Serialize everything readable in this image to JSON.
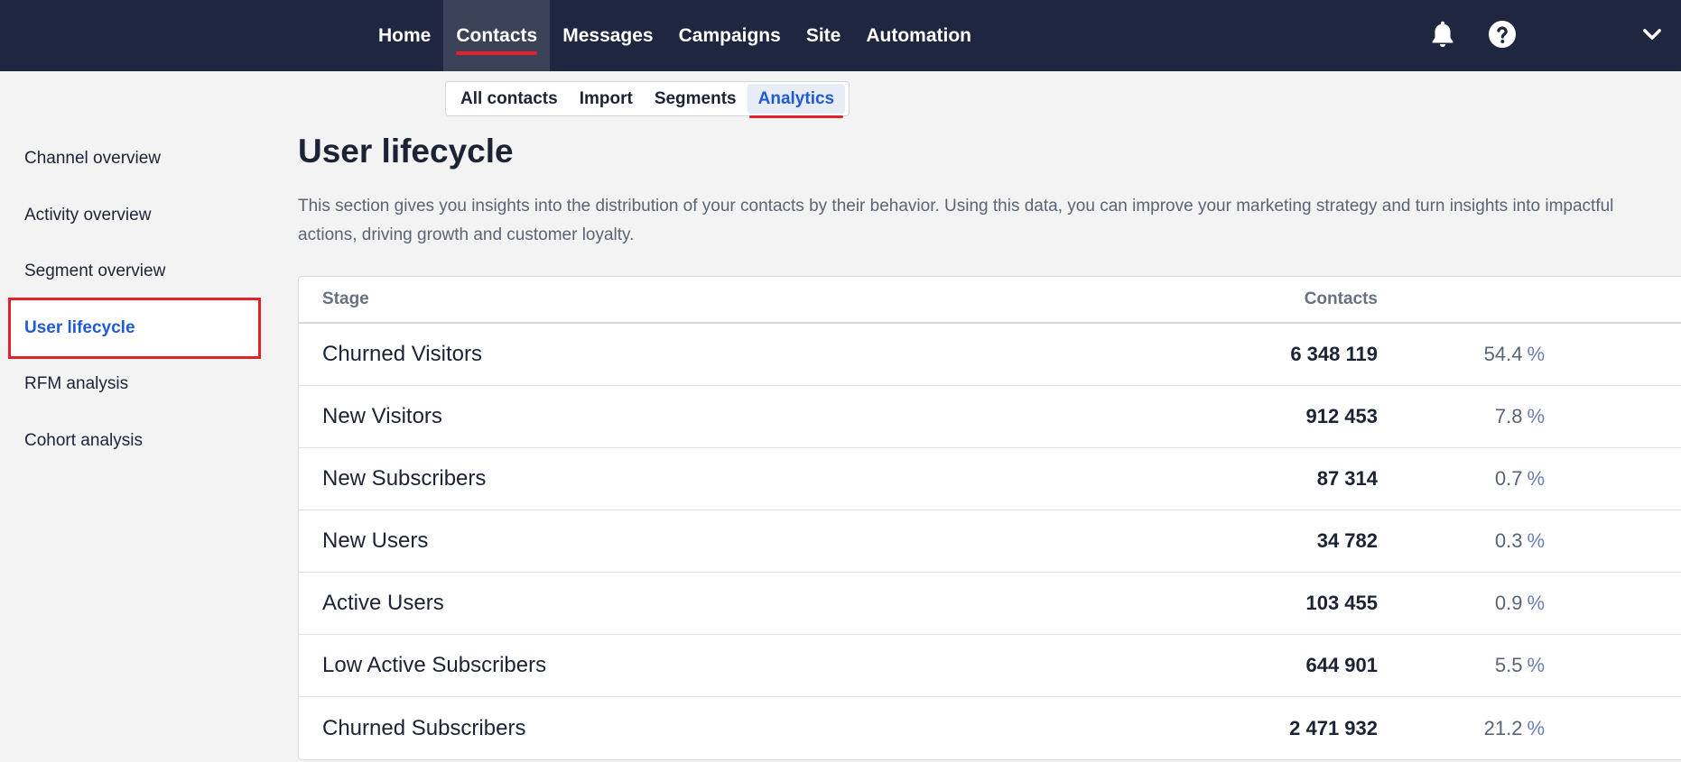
{
  "topnav": {
    "items": [
      {
        "label": "Home"
      },
      {
        "label": "Contacts",
        "active": true
      },
      {
        "label": "Messages"
      },
      {
        "label": "Campaigns"
      },
      {
        "label": "Site"
      },
      {
        "label": "Automation"
      }
    ],
    "icons": [
      "bell-icon",
      "help-icon",
      "chevron-down-icon"
    ]
  },
  "subtabs": {
    "items": [
      {
        "label": "All contacts"
      },
      {
        "label": "Import"
      },
      {
        "label": "Segments"
      },
      {
        "label": "Analytics",
        "active": true
      }
    ]
  },
  "sidebar": {
    "items": [
      {
        "label": "Channel overview"
      },
      {
        "label": "Activity overview"
      },
      {
        "label": "Segment overview"
      },
      {
        "label": "User lifecycle",
        "active": true
      },
      {
        "label": "RFM analysis"
      },
      {
        "label": "Cohort analysis"
      }
    ]
  },
  "main": {
    "title": "User lifecycle",
    "description": "This section gives you insights into the distribution of your contacts by their behavior. Using this data, you can improve your marketing strategy and turn insights into impactful actions, driving growth and customer loyalty.",
    "table": {
      "headers": {
        "stage": "Stage",
        "contacts": "Contacts"
      },
      "percent_symbol": "%",
      "rows": [
        {
          "stage": "Churned Visitors",
          "contacts": "6 348 119",
          "percent": "54.4"
        },
        {
          "stage": "New Visitors",
          "contacts": "912 453",
          "percent": "7.8"
        },
        {
          "stage": "New Subscribers",
          "contacts": "87 314",
          "percent": "0.7"
        },
        {
          "stage": "New Users",
          "contacts": "34 782",
          "percent": "0.3"
        },
        {
          "stage": "Active Users",
          "contacts": "103 455",
          "percent": "0.9"
        },
        {
          "stage": "Low Active Subscribers",
          "contacts": "644 901",
          "percent": "5.5"
        },
        {
          "stage": "Churned Subscribers",
          "contacts": "2 471 932",
          "percent": "21.2"
        }
      ]
    }
  },
  "colors": {
    "topbar": "#1f2640",
    "accent_blue": "#1f5bd6",
    "highlight_red": "#e3212b"
  }
}
